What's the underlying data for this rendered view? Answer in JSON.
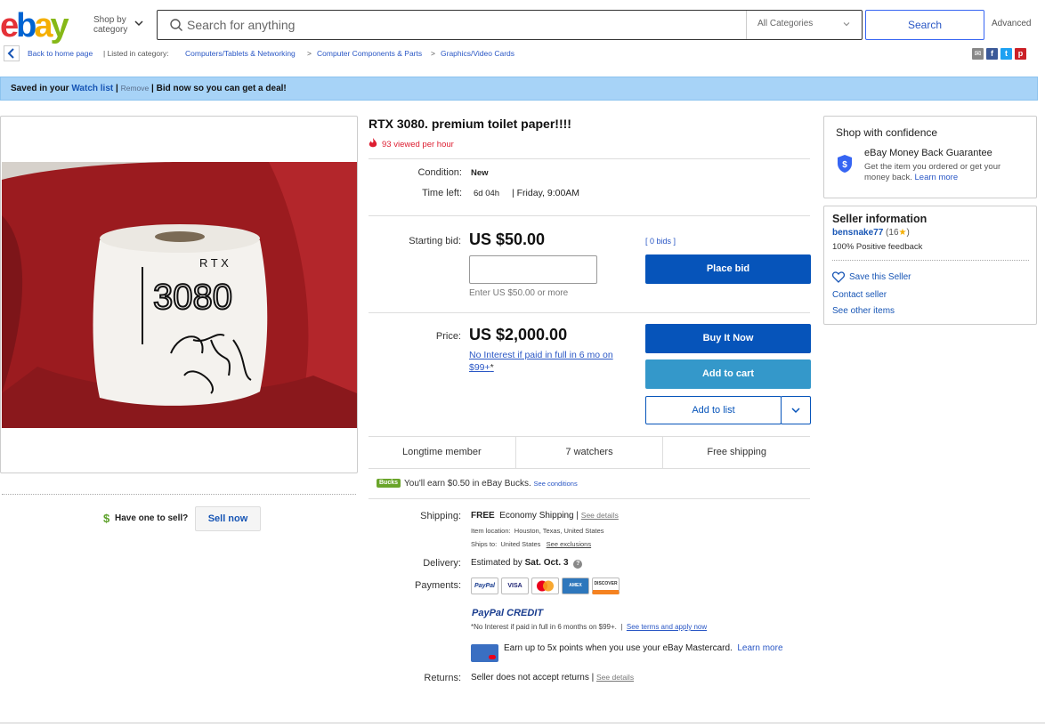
{
  "header": {
    "logo_text": "ebay",
    "shop_by_category": "Shop by category",
    "search_placeholder": "Search for anything",
    "category_select": "All Categories",
    "search_button": "Search",
    "advanced": "Advanced"
  },
  "breadcrumb": {
    "back": "Back to home page",
    "listed_in": "| Listed in category:",
    "items": [
      "Computers/Tablets & Networking",
      "Computer Components & Parts",
      "Graphics/Video Cards"
    ],
    "sep": ">"
  },
  "banner": {
    "saved_in_your": "Saved in your",
    "watch_list": "Watch list",
    "pipe1": "|",
    "remove": "Remove",
    "rest": "| Bid now so you can get a deal!"
  },
  "listing": {
    "title": "RTX 3080. premium toilet paper!!!!",
    "viewed": "93 viewed per hour",
    "condition_label": "Condition:",
    "condition_value": "New",
    "time_left_label": "Time left:",
    "time_left_value": "6d 04h",
    "time_left_end": "| Friday, 9:00AM",
    "starting_bid_label": "Starting bid:",
    "starting_bid": "US $50.00",
    "bids": "[ 0 bids ]",
    "bid_input_placeholder": "",
    "bid_note": "Enter US $50.00 or more",
    "place_bid": "Place bid",
    "price_label": "Price:",
    "price": "US $2,000.00",
    "finance_link": "No Interest if paid in full in 6 mo on $99+",
    "finance_star": "*",
    "buy_it_now": "Buy It Now",
    "add_to_cart": "Add to cart",
    "add_to_list": "Add to list"
  },
  "stats": [
    "Longtime member",
    "7 watchers",
    "Free shipping"
  ],
  "bucks": {
    "badge": "Bucks",
    "text": "You'll earn $0.50 in eBay Bucks.",
    "see_conditions": "See conditions"
  },
  "shipping": {
    "label": "Shipping:",
    "free": "FREE",
    "method": "Economy Shipping |",
    "see_details": "See details",
    "location_label": "Item location:",
    "location": "Houston, Texas, United States",
    "ships_to_label": "Ships to:",
    "ships_to": "United States",
    "see_exclusions": "See exclusions"
  },
  "delivery": {
    "label": "Delivery:",
    "text": "Estimated by",
    "date": "Sat. Oct. 3"
  },
  "payments": {
    "label": "Payments:",
    "cards": [
      "PayPal",
      "VISA",
      "MC",
      "AMEX",
      "DISCOVER"
    ],
    "paypal_credit": "PayPal CREDIT",
    "credit_note": "*No Interest if paid in full in 6 months on $99+.",
    "credit_sep": "|",
    "see_terms": "See terms and apply now",
    "mastercard_text": "Earn up to 5x points when you use your eBay Mastercard.",
    "learn_more": "Learn more"
  },
  "returns": {
    "label": "Returns:",
    "text": "Seller does not accept returns |",
    "see_details": "See details"
  },
  "sell": {
    "have_one": "Have one to sell?",
    "sell_now": "Sell now"
  },
  "confidence": {
    "title": "Shop with confidence",
    "guarantee_title": "eBay Money Back Guarantee",
    "guarantee_text": "Get the item you ordered or get your money back.",
    "learn_more": "Learn more"
  },
  "seller": {
    "title": "Seller information",
    "name": "bensnake77",
    "score_open": "(16",
    "score_close": ")",
    "feedback": "100% Positive feedback",
    "save": "Save this Seller",
    "contact": "Contact seller",
    "other_items": "See other items"
  },
  "photo_text": "RTX 3080",
  "colors": {
    "accent_blue": "#0654ba",
    "banner_bg": "#a7d3f7",
    "alert_red": "#dd1e31",
    "towel_red": "#9b1b1f"
  }
}
